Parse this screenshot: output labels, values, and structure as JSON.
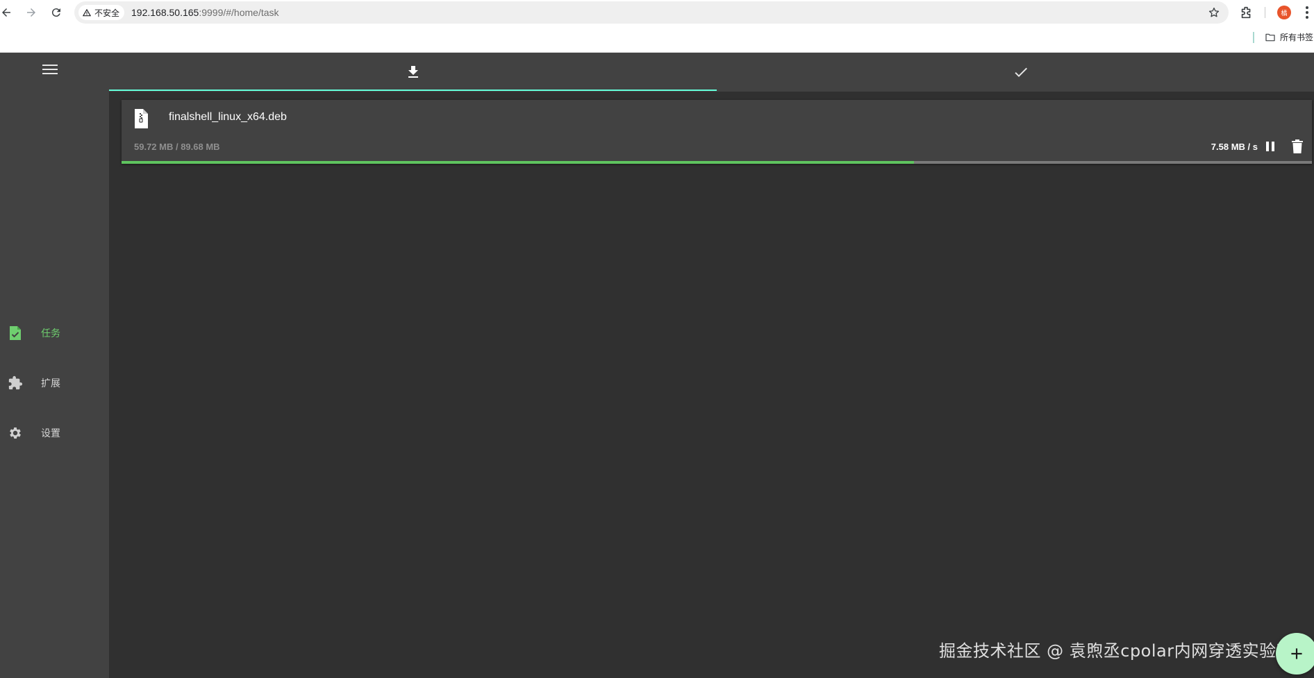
{
  "browser": {
    "security_label": "不安全",
    "url_host": "192.168.50.165",
    "url_rest": ":9999/#/home/task",
    "profile_initial": "橘",
    "bookmarks_label": "所有书签"
  },
  "sidebar": {
    "items": [
      {
        "label": "任务",
        "icon": "task-icon",
        "active": true
      },
      {
        "label": "扩展",
        "icon": "puzzle-icon",
        "active": false
      },
      {
        "label": "设置",
        "icon": "gear-icon",
        "active": false
      }
    ]
  },
  "tabs": [
    {
      "icon": "download-icon",
      "active": true
    },
    {
      "icon": "check-icon",
      "active": false
    }
  ],
  "task": {
    "file_name": "finalshell_linux_x64.deb",
    "downloaded": "59.72 MB / 89.68 MB",
    "speed": "7.58 MB / s",
    "progress": 0.6659
  },
  "watermark": "掘金技术社区 @ 袁煦丞cpolar内网穿透实验室",
  "colors": {
    "accent_tab": "#64ffda",
    "active_nav": "#6fcf6f",
    "progress": "#5fc45f",
    "fab": "#b8f4c8"
  }
}
